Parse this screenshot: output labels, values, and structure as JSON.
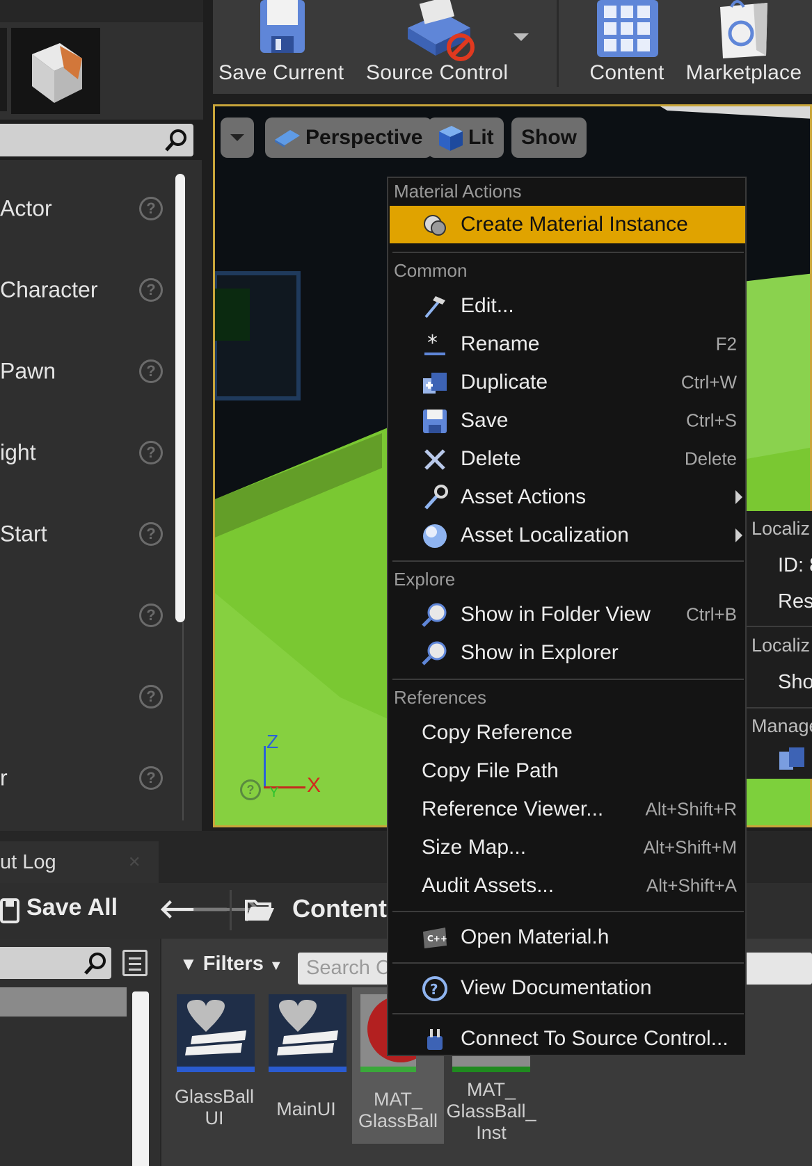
{
  "toolbar": {
    "save_current": "Save Current",
    "source_control": "Source Control",
    "content": "Content",
    "marketplace": "Marketplace"
  },
  "place_panel": {
    "items": [
      {
        "label": "Actor"
      },
      {
        "label": "Character"
      },
      {
        "label": "Pawn"
      },
      {
        "label": "ight"
      },
      {
        "label": "Start"
      },
      {
        "label": ""
      },
      {
        "label": ""
      },
      {
        "label": "r"
      }
    ]
  },
  "viewport": {
    "perspective": "Perspective",
    "lit": "Lit",
    "show": "Show",
    "axis_z": "Z",
    "axis_x": "X",
    "axis_y": "Y"
  },
  "details_panel": {
    "section1": "Localiz",
    "id_label": "ID: 8",
    "res_label": "Res",
    "section2": "Localiz",
    "sho_label": "Sho",
    "section3": "Manage"
  },
  "context_menu": {
    "sections": {
      "material_actions": "Material Actions",
      "common": "Common",
      "explore": "Explore",
      "references": "References"
    },
    "create_material_instance": "Create Material Instance",
    "edit": "Edit...",
    "rename": "Rename",
    "rename_shortcut": "F2",
    "duplicate": "Duplicate",
    "duplicate_shortcut": "Ctrl+W",
    "save": "Save",
    "save_shortcut": "Ctrl+S",
    "delete": "Delete",
    "delete_shortcut": "Delete",
    "asset_actions": "Asset Actions",
    "asset_localization": "Asset Localization",
    "show_in_folder_view": "Show in Folder View",
    "show_in_folder_view_shortcut": "Ctrl+B",
    "show_in_explorer": "Show in Explorer",
    "copy_reference": "Copy Reference",
    "copy_file_path": "Copy File Path",
    "reference_viewer": "Reference Viewer...",
    "reference_viewer_shortcut": "Alt+Shift+R",
    "size_map": "Size Map...",
    "size_map_shortcut": "Alt+Shift+M",
    "audit_assets": "Audit Assets...",
    "audit_assets_shortcut": "Alt+Shift+A",
    "open_material_h": "Open Material.h",
    "view_documentation": "View Documentation",
    "connect_to_source_control": "Connect To Source Control..."
  },
  "bottom": {
    "output_log_tab": "ut Log",
    "save_all": "Save All",
    "content_path": "Content",
    "filters": "Filters",
    "search_placeholder": "Search C",
    "assets": [
      {
        "name": "GlassBall\nUI"
      },
      {
        "name": "MainUI"
      },
      {
        "name": "MAT_\nGlassBall"
      },
      {
        "name": "MAT_\nGlassBall_\nInst"
      }
    ]
  },
  "colors": {
    "highlight": "#e0a300",
    "viewport_border": "#c8a53a",
    "floor_green": "#7ac832",
    "menu_bg": "#141414"
  }
}
